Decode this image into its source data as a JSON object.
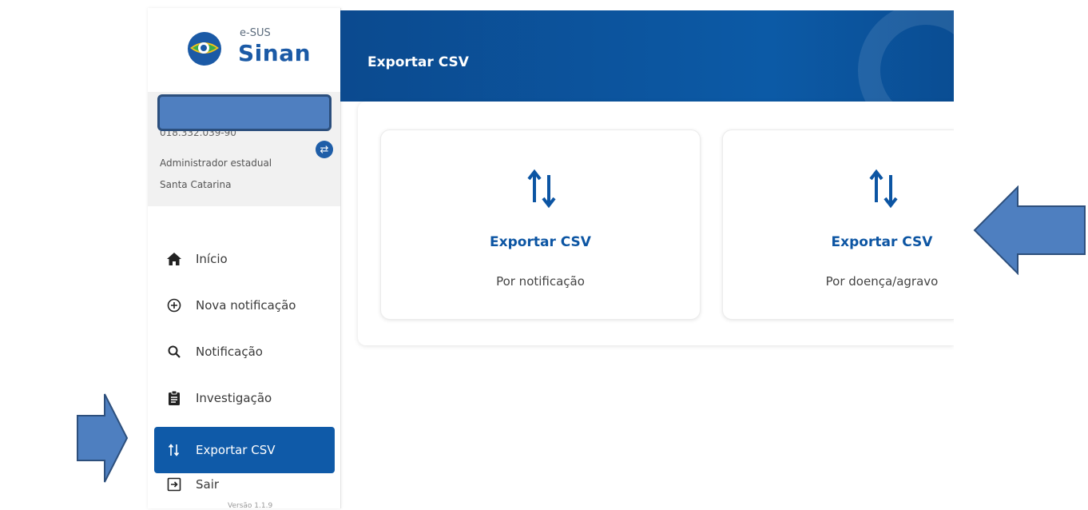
{
  "brand": {
    "small": "e-SUS",
    "big": "Sinan"
  },
  "user": {
    "cpf": "018.332.039-90",
    "role": "Administrador estadual",
    "state": "Santa Catarina"
  },
  "nav": {
    "items": [
      {
        "label": "Início",
        "icon": "home-icon"
      },
      {
        "label": "Nova notificação",
        "icon": "plus-circle-icon"
      },
      {
        "label": "Notificação",
        "icon": "search-icon"
      },
      {
        "label": "Investigação",
        "icon": "clipboard-icon"
      },
      {
        "label": "Exportar CSV",
        "icon": "swap-vertical-icon",
        "active": true
      },
      {
        "label": "Sair",
        "icon": "logout-icon"
      }
    ],
    "version": "Versão 1.1.9"
  },
  "header": {
    "title": "Exportar CSV"
  },
  "cards": [
    {
      "title": "Exportar CSV",
      "subtitle": "Por notificação",
      "icon": "swap-vertical-icon"
    },
    {
      "title": "Exportar CSV",
      "subtitle": "Por doença/agravo",
      "icon": "swap-vertical-icon"
    }
  ],
  "colors": {
    "primary": "#0c55a3",
    "header": "#0b4a8f",
    "annotation_arrow": "#4e7fc0"
  }
}
